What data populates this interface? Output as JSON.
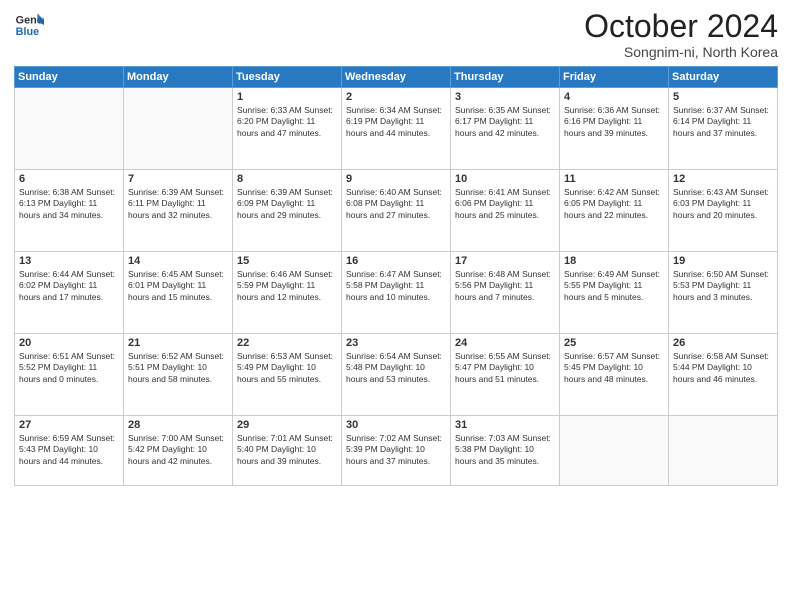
{
  "header": {
    "logo_general": "General",
    "logo_blue": "Blue",
    "month_title": "October 2024",
    "location": "Songnim-ni, North Korea"
  },
  "weekdays": [
    "Sunday",
    "Monday",
    "Tuesday",
    "Wednesday",
    "Thursday",
    "Friday",
    "Saturday"
  ],
  "weeks": [
    [
      {
        "day": "",
        "info": ""
      },
      {
        "day": "",
        "info": ""
      },
      {
        "day": "1",
        "info": "Sunrise: 6:33 AM\nSunset: 6:20 PM\nDaylight: 11 hours and 47 minutes."
      },
      {
        "day": "2",
        "info": "Sunrise: 6:34 AM\nSunset: 6:19 PM\nDaylight: 11 hours and 44 minutes."
      },
      {
        "day": "3",
        "info": "Sunrise: 6:35 AM\nSunset: 6:17 PM\nDaylight: 11 hours and 42 minutes."
      },
      {
        "day": "4",
        "info": "Sunrise: 6:36 AM\nSunset: 6:16 PM\nDaylight: 11 hours and 39 minutes."
      },
      {
        "day": "5",
        "info": "Sunrise: 6:37 AM\nSunset: 6:14 PM\nDaylight: 11 hours and 37 minutes."
      }
    ],
    [
      {
        "day": "6",
        "info": "Sunrise: 6:38 AM\nSunset: 6:13 PM\nDaylight: 11 hours and 34 minutes."
      },
      {
        "day": "7",
        "info": "Sunrise: 6:39 AM\nSunset: 6:11 PM\nDaylight: 11 hours and 32 minutes."
      },
      {
        "day": "8",
        "info": "Sunrise: 6:39 AM\nSunset: 6:09 PM\nDaylight: 11 hours and 29 minutes."
      },
      {
        "day": "9",
        "info": "Sunrise: 6:40 AM\nSunset: 6:08 PM\nDaylight: 11 hours and 27 minutes."
      },
      {
        "day": "10",
        "info": "Sunrise: 6:41 AM\nSunset: 6:06 PM\nDaylight: 11 hours and 25 minutes."
      },
      {
        "day": "11",
        "info": "Sunrise: 6:42 AM\nSunset: 6:05 PM\nDaylight: 11 hours and 22 minutes."
      },
      {
        "day": "12",
        "info": "Sunrise: 6:43 AM\nSunset: 6:03 PM\nDaylight: 11 hours and 20 minutes."
      }
    ],
    [
      {
        "day": "13",
        "info": "Sunrise: 6:44 AM\nSunset: 6:02 PM\nDaylight: 11 hours and 17 minutes."
      },
      {
        "day": "14",
        "info": "Sunrise: 6:45 AM\nSunset: 6:01 PM\nDaylight: 11 hours and 15 minutes."
      },
      {
        "day": "15",
        "info": "Sunrise: 6:46 AM\nSunset: 5:59 PM\nDaylight: 11 hours and 12 minutes."
      },
      {
        "day": "16",
        "info": "Sunrise: 6:47 AM\nSunset: 5:58 PM\nDaylight: 11 hours and 10 minutes."
      },
      {
        "day": "17",
        "info": "Sunrise: 6:48 AM\nSunset: 5:56 PM\nDaylight: 11 hours and 7 minutes."
      },
      {
        "day": "18",
        "info": "Sunrise: 6:49 AM\nSunset: 5:55 PM\nDaylight: 11 hours and 5 minutes."
      },
      {
        "day": "19",
        "info": "Sunrise: 6:50 AM\nSunset: 5:53 PM\nDaylight: 11 hours and 3 minutes."
      }
    ],
    [
      {
        "day": "20",
        "info": "Sunrise: 6:51 AM\nSunset: 5:52 PM\nDaylight: 11 hours and 0 minutes."
      },
      {
        "day": "21",
        "info": "Sunrise: 6:52 AM\nSunset: 5:51 PM\nDaylight: 10 hours and 58 minutes."
      },
      {
        "day": "22",
        "info": "Sunrise: 6:53 AM\nSunset: 5:49 PM\nDaylight: 10 hours and 55 minutes."
      },
      {
        "day": "23",
        "info": "Sunrise: 6:54 AM\nSunset: 5:48 PM\nDaylight: 10 hours and 53 minutes."
      },
      {
        "day": "24",
        "info": "Sunrise: 6:55 AM\nSunset: 5:47 PM\nDaylight: 10 hours and 51 minutes."
      },
      {
        "day": "25",
        "info": "Sunrise: 6:57 AM\nSunset: 5:45 PM\nDaylight: 10 hours and 48 minutes."
      },
      {
        "day": "26",
        "info": "Sunrise: 6:58 AM\nSunset: 5:44 PM\nDaylight: 10 hours and 46 minutes."
      }
    ],
    [
      {
        "day": "27",
        "info": "Sunrise: 6:59 AM\nSunset: 5:43 PM\nDaylight: 10 hours and 44 minutes."
      },
      {
        "day": "28",
        "info": "Sunrise: 7:00 AM\nSunset: 5:42 PM\nDaylight: 10 hours and 42 minutes."
      },
      {
        "day": "29",
        "info": "Sunrise: 7:01 AM\nSunset: 5:40 PM\nDaylight: 10 hours and 39 minutes."
      },
      {
        "day": "30",
        "info": "Sunrise: 7:02 AM\nSunset: 5:39 PM\nDaylight: 10 hours and 37 minutes."
      },
      {
        "day": "31",
        "info": "Sunrise: 7:03 AM\nSunset: 5:38 PM\nDaylight: 10 hours and 35 minutes."
      },
      {
        "day": "",
        "info": ""
      },
      {
        "day": "",
        "info": ""
      }
    ]
  ]
}
